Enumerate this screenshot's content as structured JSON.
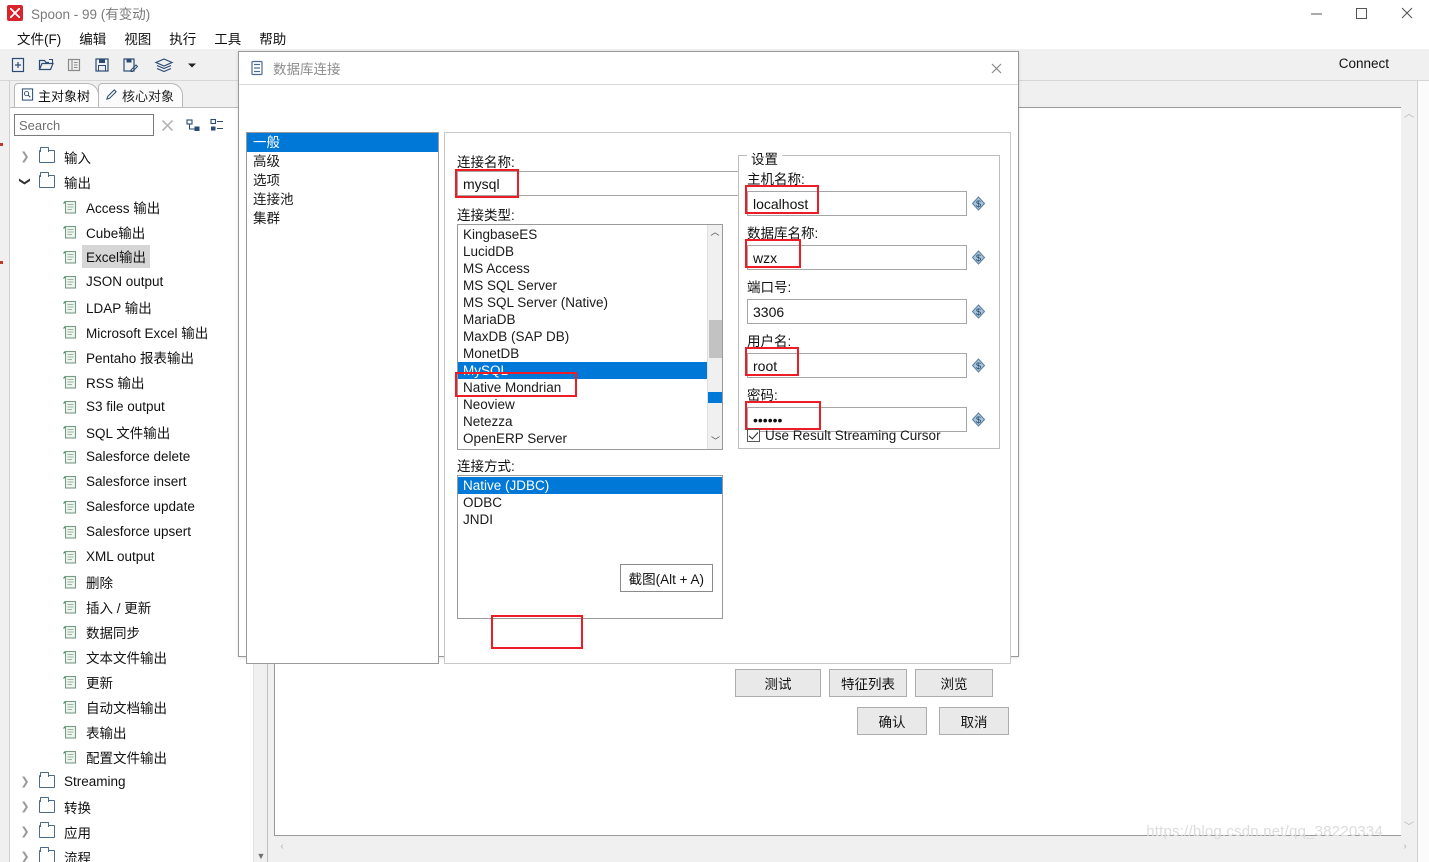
{
  "window": {
    "title": "Spoon - 99 (有变动)",
    "app_icon": "spoon-icon",
    "minimize": "minimize-icon",
    "maximize": "maximize-icon",
    "close": "close-icon"
  },
  "menubar": {
    "items": [
      {
        "label": "文件(F)"
      },
      {
        "label": "编辑"
      },
      {
        "label": "视图"
      },
      {
        "label": "执行"
      },
      {
        "label": "工具"
      },
      {
        "label": "帮助"
      }
    ]
  },
  "toolbar": {
    "buttons": [
      {
        "name": "new-file-icon"
      },
      {
        "name": "open-file-icon"
      },
      {
        "name": "explorer-icon"
      },
      {
        "name": "save-icon"
      },
      {
        "name": "save-as-icon"
      },
      {
        "name": "layers-icon"
      },
      {
        "name": "dropdown-arrow-icon"
      }
    ],
    "connect_label": "Connect"
  },
  "sidebar": {
    "tabs": [
      {
        "label": "主对象树",
        "icon": "view-icon",
        "active": true
      },
      {
        "label": "核心对象",
        "icon": "pencil-icon",
        "active": false
      }
    ],
    "search": {
      "value": "",
      "placeholder": "Search"
    },
    "search_clear_icon": "clear-icon",
    "tool_icons": [
      "expand-all-icon",
      "collapse-all-icon"
    ],
    "tree": [
      {
        "label": "输入",
        "type": "folder",
        "expanded": false,
        "depth": 0
      },
      {
        "label": "输出",
        "type": "folder",
        "expanded": true,
        "depth": 0
      },
      {
        "label": "Access 输出",
        "type": "step",
        "depth": 1,
        "selected": false
      },
      {
        "label": "Cube输出",
        "type": "step",
        "depth": 1,
        "selected": false
      },
      {
        "label": "Excel输出",
        "type": "step",
        "depth": 1,
        "selected": true
      },
      {
        "label": "JSON output",
        "type": "step",
        "depth": 1,
        "selected": false
      },
      {
        "label": "LDAP 输出",
        "type": "step",
        "depth": 1,
        "selected": false
      },
      {
        "label": "Microsoft Excel 输出",
        "type": "step",
        "depth": 1,
        "selected": false
      },
      {
        "label": "Pentaho 报表输出",
        "type": "step",
        "depth": 1,
        "selected": false
      },
      {
        "label": "RSS 输出",
        "type": "step",
        "depth": 1,
        "selected": false
      },
      {
        "label": "S3 file output",
        "type": "step",
        "depth": 1,
        "selected": false
      },
      {
        "label": "SQL 文件输出",
        "type": "step",
        "depth": 1,
        "selected": false
      },
      {
        "label": "Salesforce delete",
        "type": "step",
        "depth": 1,
        "selected": false
      },
      {
        "label": "Salesforce insert",
        "type": "step",
        "depth": 1,
        "selected": false
      },
      {
        "label": "Salesforce update",
        "type": "step",
        "depth": 1,
        "selected": false
      },
      {
        "label": "Salesforce upsert",
        "type": "step",
        "depth": 1,
        "selected": false
      },
      {
        "label": "XML output",
        "type": "step",
        "depth": 1,
        "selected": false
      },
      {
        "label": "删除",
        "type": "step",
        "depth": 1,
        "selected": false
      },
      {
        "label": "插入 / 更新",
        "type": "step",
        "depth": 1,
        "selected": false
      },
      {
        "label": "数据同步",
        "type": "step",
        "depth": 1,
        "selected": false
      },
      {
        "label": "文本文件输出",
        "type": "step",
        "depth": 1,
        "selected": false
      },
      {
        "label": "更新",
        "type": "step",
        "depth": 1,
        "selected": false
      },
      {
        "label": "自动文档输出",
        "type": "step",
        "depth": 1,
        "selected": false
      },
      {
        "label": "表输出",
        "type": "step",
        "depth": 1,
        "selected": false
      },
      {
        "label": "配置文件输出",
        "type": "step",
        "depth": 1,
        "selected": false
      },
      {
        "label": "Streaming",
        "type": "folder",
        "expanded": false,
        "depth": 0
      },
      {
        "label": "转换",
        "type": "folder",
        "expanded": false,
        "depth": 0
      },
      {
        "label": "应用",
        "type": "folder",
        "expanded": false,
        "depth": 0
      },
      {
        "label": "流程",
        "type": "folder",
        "expanded": false,
        "depth": 0
      }
    ]
  },
  "dialog": {
    "title": "数据库连接",
    "title_icon": "database-icon",
    "close_icon": "close-icon",
    "nav": [
      {
        "label": "一般",
        "selected": true
      },
      {
        "label": "高级",
        "selected": false
      },
      {
        "label": "选项",
        "selected": false
      },
      {
        "label": "连接池",
        "selected": false
      },
      {
        "label": "集群",
        "selected": false
      }
    ],
    "connection_name": {
      "label": "连接名称:",
      "value": "mysql",
      "highlighted": true
    },
    "connection_type": {
      "label": "连接类型:",
      "selected": "MySQL",
      "options": [
        "KingbaseES",
        "LucidDB",
        "MS Access",
        "MS SQL Server",
        "MS SQL Server (Native)",
        "MariaDB",
        "MaxDB (SAP DB)",
        "MonetDB",
        "MySQL",
        "Native Mondrian",
        "Neoview",
        "Netezza",
        "OpenERP Server"
      ]
    },
    "access_method": {
      "label": "连接方式:",
      "selected": "Native (JDBC)",
      "options": [
        "Native (JDBC)",
        "ODBC",
        "JNDI"
      ]
    },
    "screenshot_hint": "截图(Alt + A)",
    "settings": {
      "legend": "设置",
      "fields": [
        {
          "name": "hostname",
          "label": "主机名称:",
          "value": "localhost",
          "highlighted": true,
          "masked": false
        },
        {
          "name": "database-name",
          "label": "数据库名称:",
          "value": "wzx",
          "highlighted": true,
          "masked": false
        },
        {
          "name": "port",
          "label": "端口号:",
          "value": "3306",
          "highlighted": false,
          "masked": false
        },
        {
          "name": "username",
          "label": "用户名:",
          "value": "root",
          "highlighted": true,
          "masked": false
        },
        {
          "name": "password",
          "label": "密码:",
          "value": "••••••",
          "highlighted": true,
          "masked": true
        }
      ],
      "checkbox": {
        "label": "Use Result Streaming Cursor",
        "checked": true
      }
    },
    "action_buttons": [
      {
        "name": "test-button",
        "label": "测试",
        "highlighted": true
      },
      {
        "name": "feature-list-button",
        "label": "特征列表",
        "highlighted": false
      },
      {
        "name": "explore-button",
        "label": "浏览",
        "highlighted": false
      }
    ],
    "footer_buttons": [
      {
        "name": "ok-button",
        "label": "确认"
      },
      {
        "name": "cancel-button",
        "label": "取消"
      }
    ]
  },
  "watermark": {
    "text": "https://blog.csdn.net/qq_38220334"
  },
  "colors": {
    "accent": "#0078d7",
    "highlight_red": "#ee1c24",
    "toolbar_bg": "#f0f0f0",
    "brand_red": "#d9242b"
  }
}
